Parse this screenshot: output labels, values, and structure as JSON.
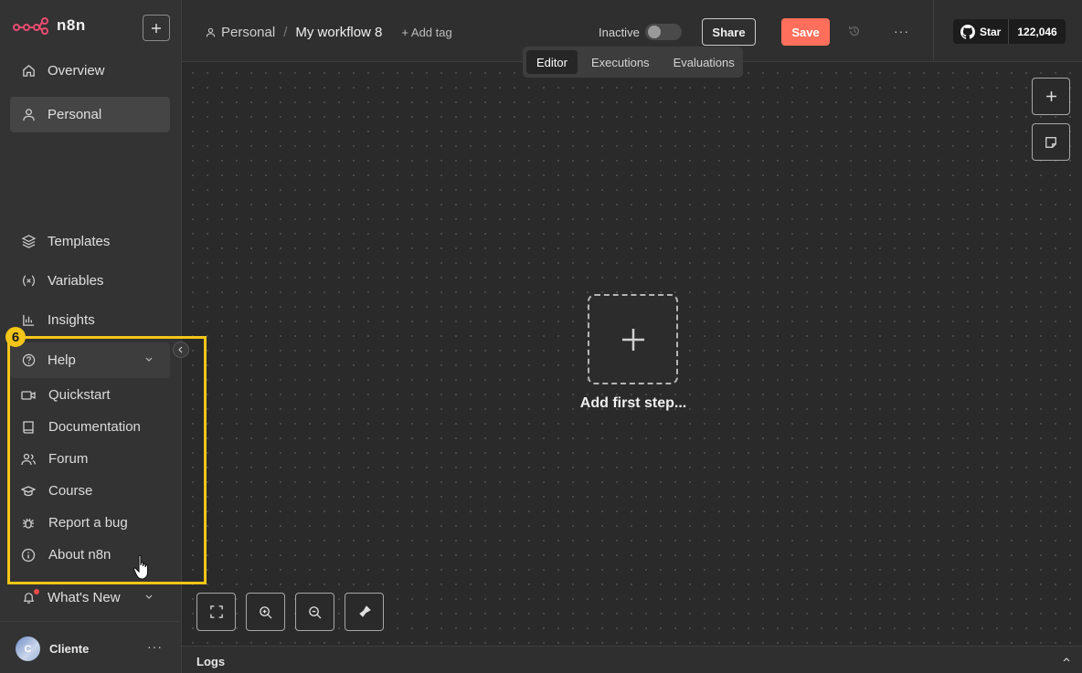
{
  "app": {
    "name": "n8n"
  },
  "sidebar": {
    "top_items": [
      {
        "label": "Overview",
        "icon": "home-icon"
      },
      {
        "label": "Personal",
        "icon": "user-icon"
      }
    ],
    "bottom_items": [
      {
        "label": "Templates",
        "icon": "box-icon"
      },
      {
        "label": "Variables",
        "icon": "variable-icon"
      },
      {
        "label": "Insights",
        "icon": "bar-chart-icon"
      }
    ],
    "help": {
      "label": "Help",
      "items": [
        {
          "label": "Quickstart",
          "icon": "video-icon"
        },
        {
          "label": "Documentation",
          "icon": "book-icon"
        },
        {
          "label": "Forum",
          "icon": "users-icon"
        },
        {
          "label": "Course",
          "icon": "graduation-cap-icon"
        },
        {
          "label": "Report a bug",
          "icon": "bug-icon"
        },
        {
          "label": "About n8n",
          "icon": "info-icon"
        }
      ]
    },
    "whats_new": "What's New",
    "user": {
      "initial": "C",
      "name": "Cliente"
    },
    "step_badge": "6"
  },
  "header": {
    "project": "Personal",
    "workflow": "My workflow 8",
    "add_tag": "+ Add tag",
    "status_label": "Inactive",
    "share_label": "Share",
    "save_label": "Save",
    "github_star": "Star",
    "github_count": "122,046"
  },
  "tabs": [
    {
      "label": "Editor",
      "active": true
    },
    {
      "label": "Executions",
      "active": false
    },
    {
      "label": "Evaluations",
      "active": false
    }
  ],
  "canvas": {
    "add_first_step": "Add first step..."
  },
  "logs": {
    "label": "Logs"
  },
  "colors": {
    "accent": "#ff6f5c",
    "highlight": "#f5c518",
    "notification": "#ea4b4b"
  }
}
